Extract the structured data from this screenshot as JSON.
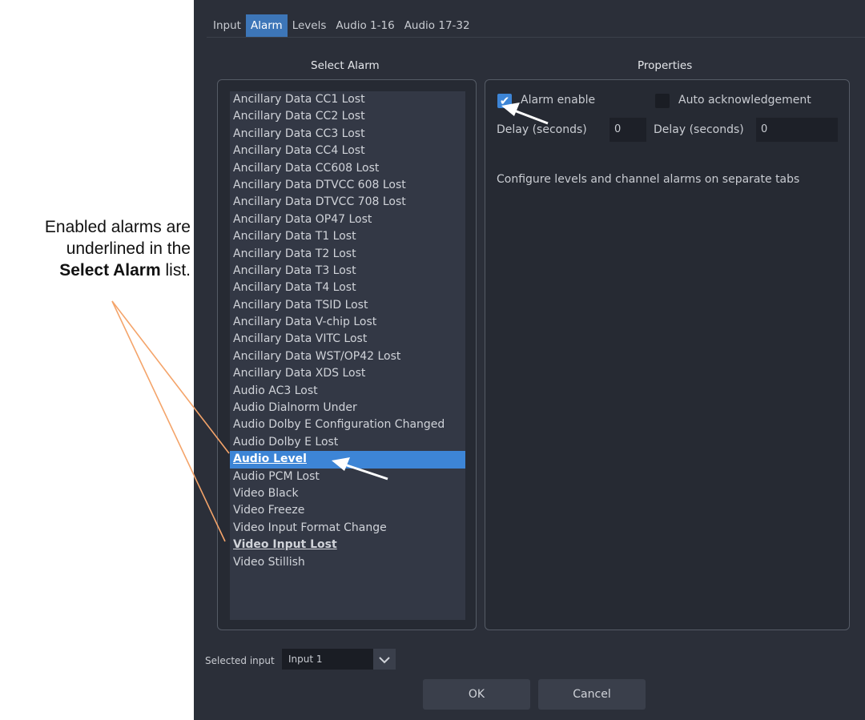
{
  "callout": {
    "line1": "Enabled alarms are",
    "line2": "underlined in the",
    "bold": "Select Alarm",
    "tail": " list."
  },
  "tabs": [
    {
      "label": "Input",
      "active": false
    },
    {
      "label": "Alarm",
      "active": true
    },
    {
      "label": "Levels",
      "active": false
    },
    {
      "label": "Audio 1-16",
      "active": false
    },
    {
      "label": "Audio 17-32",
      "active": false
    }
  ],
  "select_alarm": {
    "title": "Select Alarm",
    "items": [
      {
        "label": "Ancillary Data CC1 Lost",
        "enabled": false,
        "selected": false
      },
      {
        "label": "Ancillary Data CC2 Lost",
        "enabled": false,
        "selected": false
      },
      {
        "label": "Ancillary Data CC3 Lost",
        "enabled": false,
        "selected": false
      },
      {
        "label": "Ancillary Data CC4 Lost",
        "enabled": false,
        "selected": false
      },
      {
        "label": "Ancillary Data CC608 Lost",
        "enabled": false,
        "selected": false
      },
      {
        "label": "Ancillary Data DTVCC 608 Lost",
        "enabled": false,
        "selected": false
      },
      {
        "label": "Ancillary Data DTVCC 708 Lost",
        "enabled": false,
        "selected": false
      },
      {
        "label": "Ancillary Data OP47 Lost",
        "enabled": false,
        "selected": false
      },
      {
        "label": "Ancillary Data T1 Lost",
        "enabled": false,
        "selected": false
      },
      {
        "label": "Ancillary Data T2 Lost",
        "enabled": false,
        "selected": false
      },
      {
        "label": "Ancillary Data T3 Lost",
        "enabled": false,
        "selected": false
      },
      {
        "label": "Ancillary Data T4 Lost",
        "enabled": false,
        "selected": false
      },
      {
        "label": "Ancillary Data TSID Lost",
        "enabled": false,
        "selected": false
      },
      {
        "label": "Ancillary Data V-chip Lost",
        "enabled": false,
        "selected": false
      },
      {
        "label": "Ancillary Data VITC Lost",
        "enabled": false,
        "selected": false
      },
      {
        "label": "Ancillary Data WST/OP42 Lost",
        "enabled": false,
        "selected": false
      },
      {
        "label": "Ancillary Data XDS Lost",
        "enabled": false,
        "selected": false
      },
      {
        "label": "Audio AC3 Lost",
        "enabled": false,
        "selected": false
      },
      {
        "label": "Audio Dialnorm Under",
        "enabled": false,
        "selected": false
      },
      {
        "label": "Audio Dolby E Configuration Changed",
        "enabled": false,
        "selected": false
      },
      {
        "label": "Audio Dolby E Lost",
        "enabled": false,
        "selected": false
      },
      {
        "label": "Audio Level",
        "enabled": true,
        "selected": true
      },
      {
        "label": "Audio PCM Lost",
        "enabled": false,
        "selected": false
      },
      {
        "label": "Video Black",
        "enabled": false,
        "selected": false
      },
      {
        "label": "Video Freeze",
        "enabled": false,
        "selected": false
      },
      {
        "label": "Video Input Format Change",
        "enabled": false,
        "selected": false
      },
      {
        "label": "Video Input Lost",
        "enabled": true,
        "selected": false
      },
      {
        "label": "Video Stillish",
        "enabled": false,
        "selected": false
      }
    ]
  },
  "properties": {
    "title": "Properties",
    "alarm_enable": {
      "label": "Alarm enable",
      "checked": true
    },
    "auto_ack": {
      "label": "Auto acknowledgement",
      "checked": false
    },
    "delay1": {
      "label": "Delay (seconds)",
      "value": "0"
    },
    "delay2": {
      "label": "Delay (seconds)",
      "value": "0"
    },
    "note": "Configure levels and channel alarms on separate tabs"
  },
  "footer": {
    "selected_input_label": "Selected input",
    "selected_input_value": "Input 1",
    "ok": "OK",
    "cancel": "Cancel"
  },
  "colors": {
    "dialog_bg": "#2b2f39",
    "accent": "#3d85d6",
    "callout_line": "#f4a46a",
    "arrow": "#ffffff"
  }
}
